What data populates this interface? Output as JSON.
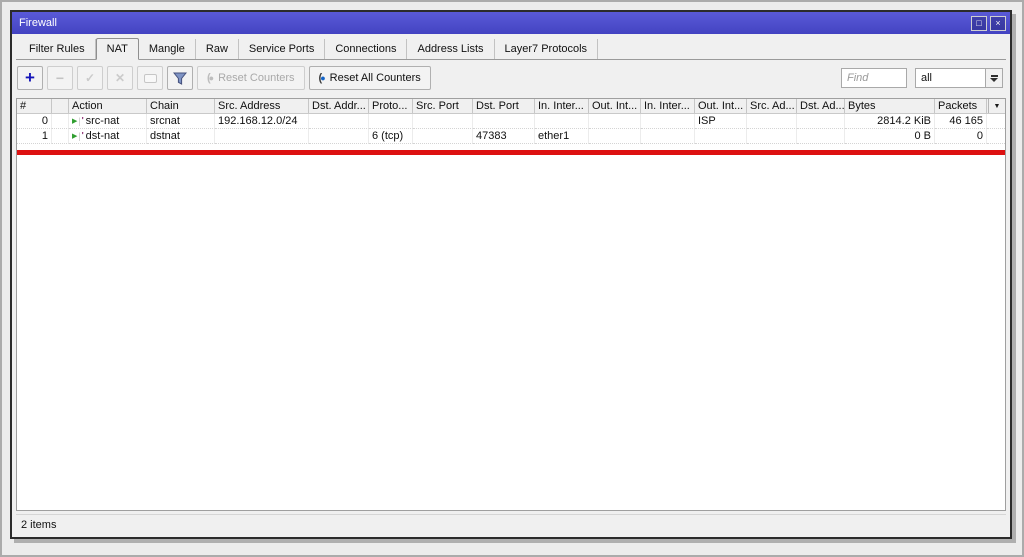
{
  "window": {
    "title": "Firewall"
  },
  "icons": {
    "add": "+",
    "remove": "−",
    "enable": "✓",
    "disable": "✕",
    "comment": "comment-bubble",
    "filter": "funnel",
    "reset_paren": "(",
    "reset_dot": "●",
    "rule_flag": "▶",
    "action_mark": "'",
    "dropdown": "down-arrow-with-bar",
    "column_selector": "▼",
    "maximize": "□",
    "close": "×"
  },
  "tabs": [
    {
      "label": "Filter Rules"
    },
    {
      "label": "NAT"
    },
    {
      "label": "Mangle"
    },
    {
      "label": "Raw"
    },
    {
      "label": "Service Ports"
    },
    {
      "label": "Connections"
    },
    {
      "label": "Address Lists"
    },
    {
      "label": "Layer7 Protocols"
    }
  ],
  "toolbar": {
    "reset_counters_label": "Reset Counters",
    "reset_all_counters_label": "Reset All Counters",
    "find_placeholder": "Find",
    "filter_value": "all"
  },
  "table": {
    "columns": [
      "#",
      "",
      "Action",
      "Chain",
      "Src. Address",
      "Dst. Addr...",
      "Proto...",
      "Src. Port",
      "Dst. Port",
      "In. Inter...",
      "Out. Int...",
      "In. Inter...",
      "Out. Int...",
      "Src. Ad...",
      "Dst. Ad...",
      "Bytes",
      "Packets"
    ],
    "rows": [
      {
        "num": "0",
        "action": "src-nat",
        "chain": "srcnat",
        "src_address": "192.168.12.0/24",
        "dst_address": "",
        "protocol": "",
        "src_port": "",
        "dst_port": "",
        "in_interface": "",
        "out_interface": "",
        "in_interface_list": "",
        "out_interface_list": "ISP",
        "src_address_list": "",
        "dst_address_list": "",
        "bytes": "2814.2 KiB",
        "packets": "46 165"
      },
      {
        "num": "1",
        "action": "dst-nat",
        "chain": "dstnat",
        "src_address": "",
        "dst_address": "",
        "protocol": "6 (tcp)",
        "src_port": "",
        "dst_port": "47383",
        "in_interface": "ether1",
        "out_interface": "",
        "in_interface_list": "",
        "out_interface_list": "",
        "src_address_list": "",
        "dst_address_list": "",
        "bytes": "0 B",
        "packets": "0"
      }
    ]
  },
  "status": {
    "text": "2 items"
  },
  "colors": {
    "titlebar": "#4a4ac8",
    "highlight_red": "#dd1111",
    "add_blue": "#1414b8",
    "reset_blue": "#1565c8"
  }
}
